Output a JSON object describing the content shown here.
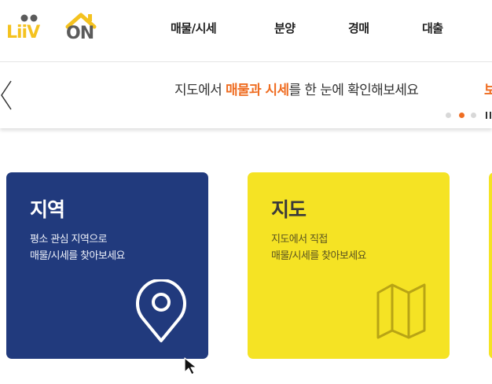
{
  "logo": {
    "text_liiv": "LiiV",
    "text_on": "ON"
  },
  "nav": {
    "items": [
      {
        "label": "매물/시세"
      },
      {
        "label": "분양"
      },
      {
        "label": "경매"
      },
      {
        "label": "대출"
      }
    ]
  },
  "banner": {
    "text_before": "지도에서 ",
    "text_highlight": "매물과 시세",
    "text_after": "를 한 눈에 확인해보세요",
    "next_slide_peek": "보",
    "dots_count": 3,
    "active_dot": 1
  },
  "cards": [
    {
      "title": "지역",
      "desc_line1": "평소 관심 지역으로",
      "desc_line2": "매물/시세를 찾아보세요",
      "icon": "location-pin-icon"
    },
    {
      "title": "지도",
      "desc_line1": "지도에서 직접",
      "desc_line2": "매물/시세를 찾아보세요",
      "icon": "folded-map-icon"
    }
  ],
  "colors": {
    "accent_orange": "#ef6d22",
    "card_navy": "#213a7d",
    "card_yellow": "#f5e324",
    "logo_yellow": "#f4c21f",
    "logo_dark": "#5b5b5b"
  }
}
